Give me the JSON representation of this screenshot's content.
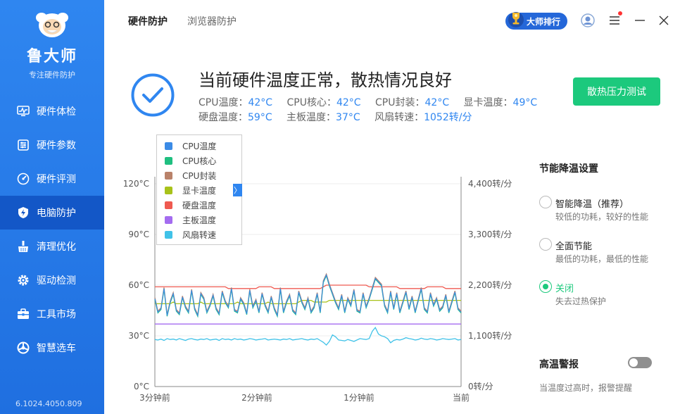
{
  "sidebar": {
    "app_name": "鲁大师",
    "tagline": "专注硬件防护",
    "items": [
      {
        "label": "硬件体检",
        "icon": "monitor-pulse-icon"
      },
      {
        "label": "硬件参数",
        "icon": "sliders-icon"
      },
      {
        "label": "硬件评测",
        "icon": "speedometer-icon"
      },
      {
        "label": "电脑防护",
        "icon": "shield-bolt-icon",
        "active": true
      },
      {
        "label": "清理优化",
        "icon": "broom-icon"
      },
      {
        "label": "驱动检测",
        "icon": "gear-icon"
      },
      {
        "label": "工具市场",
        "icon": "toolbox-icon"
      },
      {
        "label": "智慧选车",
        "icon": "car-wheel-icon"
      }
    ],
    "version": "6.1024.4050.809"
  },
  "header": {
    "tabs": [
      {
        "label": "硬件防护",
        "active": true
      },
      {
        "label": "浏览器防护",
        "active": false
      }
    ],
    "rank_label": "大师排行"
  },
  "status": {
    "title": "当前硬件温度正常，散热情况良好",
    "readings_row1": [
      {
        "label": "CPU温度：",
        "value": "42°C"
      },
      {
        "label": "CPU核心：",
        "value": "42°C"
      },
      {
        "label": "CPU封装：",
        "value": "42°C"
      },
      {
        "label": "显卡温度：",
        "value": "49°C"
      }
    ],
    "readings_row2": [
      {
        "label": "硬盘温度：",
        "value": "59°C"
      },
      {
        "label": "主板温度：",
        "value": "37°C"
      },
      {
        "label": "风扇转速：",
        "value": "1052转/分"
      }
    ],
    "stress_button": "散热压力测试"
  },
  "chart_data": {
    "type": "line",
    "x": [
      "3分钟前",
      "2分钟前",
      "1分钟前",
      "当前"
    ],
    "y_left_ticks": [
      "0°C",
      "30°C",
      "60°C",
      "90°C",
      "120°C"
    ],
    "y_right_ticks": [
      "0转/分",
      "1,100转/分",
      "2,200转/分",
      "3,300转/分",
      "4,400转/分"
    ],
    "ylim_left": [
      0,
      120
    ],
    "ylim_right": [
      0,
      4400
    ],
    "legend_toggle": "〉",
    "series": [
      {
        "name": "CPU温度",
        "color": "#3b8be6",
        "axis": "left"
      },
      {
        "name": "CPU核心",
        "color": "#1fbf80",
        "axis": "left"
      },
      {
        "name": "CPU封装",
        "color": "#b9826a",
        "axis": "left"
      },
      {
        "name": "显卡温度",
        "color": "#a8c21a",
        "axis": "left"
      },
      {
        "name": "硬盘温度",
        "color": "#ef5a50",
        "axis": "left"
      },
      {
        "name": "主板温度",
        "color": "#a46cf0",
        "axis": "left"
      },
      {
        "name": "风扇转速",
        "color": "#40c2e8",
        "axis": "right"
      }
    ],
    "curves": {
      "cpu": [
        52,
        44,
        46,
        58,
        42,
        50,
        55,
        45,
        43,
        53,
        47,
        44,
        57,
        46,
        42,
        55,
        52,
        44,
        48,
        54,
        46,
        43,
        56,
        50,
        47,
        58,
        45,
        44,
        52,
        49,
        43,
        57,
        47,
        51,
        44,
        55,
        48,
        44,
        53,
        46,
        42,
        58,
        44,
        50,
        54,
        45,
        43,
        56,
        50,
        46,
        52,
        44,
        47,
        55,
        44,
        62,
        66,
        60,
        55,
        50,
        46,
        54,
        44,
        52,
        48,
        57,
        45,
        44,
        55,
        47,
        52,
        58,
        64,
        62,
        60,
        48,
        44,
        56,
        46,
        55,
        44,
        50,
        56,
        46,
        53,
        44,
        51,
        58,
        46,
        44,
        55,
        48,
        52,
        45,
        47,
        54,
        44,
        50,
        56,
        46,
        44
      ],
      "gpu": [
        49,
        49,
        49,
        49,
        49,
        49,
        50,
        49,
        49,
        49,
        49,
        49,
        49,
        49,
        49,
        50,
        49,
        49,
        49,
        49,
        49,
        49,
        49,
        49,
        49,
        49,
        49,
        50,
        49,
        49,
        49,
        49,
        49,
        49,
        49,
        49,
        49,
        50,
        49,
        49,
        49,
        49,
        49,
        49,
        49,
        49,
        49,
        50,
        51,
        51,
        51,
        51,
        50,
        50,
        50,
        50,
        50,
        51,
        51,
        51,
        51,
        51,
        51,
        51,
        51,
        51,
        51,
        51,
        51,
        51,
        51,
        51,
        51,
        51,
        51,
        51,
        51,
        51,
        51,
        51,
        51,
        51,
        51,
        51,
        51,
        51,
        51,
        51,
        51,
        51,
        51,
        51,
        51,
        51,
        51,
        51,
        51,
        51,
        51,
        51,
        51
      ],
      "disk": [
        59,
        59,
        59,
        59,
        59,
        59,
        59,
        59,
        59,
        59,
        59,
        59,
        59,
        59,
        59,
        59,
        59,
        59,
        59,
        59,
        59,
        59,
        59,
        59,
        58,
        58,
        58,
        58,
        58,
        58,
        58,
        58,
        58,
        58,
        59,
        59,
        59,
        59,
        59,
        58,
        58,
        58,
        58,
        58,
        58,
        58,
        58,
        58,
        58,
        58,
        58,
        58,
        58,
        58,
        58,
        59,
        60,
        60,
        60,
        60,
        60,
        60,
        60,
        60,
        60,
        60,
        60,
        60,
        60,
        60,
        59,
        59,
        59,
        59,
        59,
        59,
        59,
        59,
        59,
        59,
        58,
        58,
        58,
        58,
        58,
        58,
        58,
        58,
        58,
        59,
        59,
        59,
        59,
        59,
        59,
        58,
        58,
        58,
        58,
        58,
        58
      ],
      "board": [
        37,
        37,
        37,
        37,
        37,
        37,
        37,
        37,
        37,
        37,
        37,
        37,
        37,
        37,
        37,
        37,
        37,
        37,
        37,
        37,
        37,
        37,
        37,
        37,
        37,
        37,
        37,
        37,
        37,
        37,
        37,
        37,
        37,
        37,
        37,
        37,
        37,
        37,
        37,
        37,
        37,
        37,
        37,
        37,
        37,
        37,
        37,
        37,
        37,
        37,
        37,
        37,
        37,
        37,
        37,
        37,
        37,
        37,
        37,
        37,
        37,
        37,
        37,
        37,
        37,
        37,
        37,
        37,
        37,
        37,
        37,
        37,
        37,
        37,
        37,
        37,
        37,
        37,
        37,
        37,
        37,
        37,
        37,
        37,
        37,
        37,
        37,
        37,
        37,
        37,
        37,
        37,
        37,
        37,
        37,
        37,
        37,
        37,
        37,
        37,
        37
      ],
      "fan": [
        1020,
        1010,
        1030,
        1000,
        1040,
        1020,
        1030,
        1010,
        1040,
        1020,
        1000,
        1030,
        1040,
        1020,
        1010,
        1030,
        1020,
        1040,
        1010,
        1020,
        1030,
        1000,
        1040,
        1020,
        1030,
        1010,
        1040,
        1020,
        1030,
        1010,
        1020,
        1040,
        1030,
        1010,
        1020,
        1030,
        1040,
        1010,
        1020,
        1030,
        1020,
        1010,
        1030,
        1020,
        1040,
        1010,
        1020,
        1030,
        1040,
        1020,
        1010,
        1030,
        1020,
        1040,
        1000,
        960,
        900,
        980,
        1120,
        1080,
        1010,
        1000,
        990,
        1020,
        1000,
        980,
        1010,
        1040,
        1030,
        1020,
        1040,
        1200,
        1280,
        1140,
        1100,
        1080,
        1040,
        950,
        1000,
        1020,
        1010,
        1030,
        1060,
        1040,
        1030,
        1010,
        1020,
        1050,
        1030,
        1020,
        1040,
        1030,
        1010,
        1020,
        1040,
        1030,
        1020,
        1030,
        1040,
        1010,
        1020
      ]
    }
  },
  "cooling": {
    "title": "节能降温设置",
    "options": [
      {
        "label": "智能降温（推荐）",
        "desc": "较低的功耗，较好的性能",
        "selected": false
      },
      {
        "label": "全面节能",
        "desc": "最低的功耗，最低的性能",
        "selected": false
      },
      {
        "label": "关闭",
        "desc": "失去过热保护",
        "selected": true
      }
    ]
  },
  "alarm": {
    "title": "高温警报",
    "desc": "当温度过高时，报警提醒",
    "enabled": false
  }
}
